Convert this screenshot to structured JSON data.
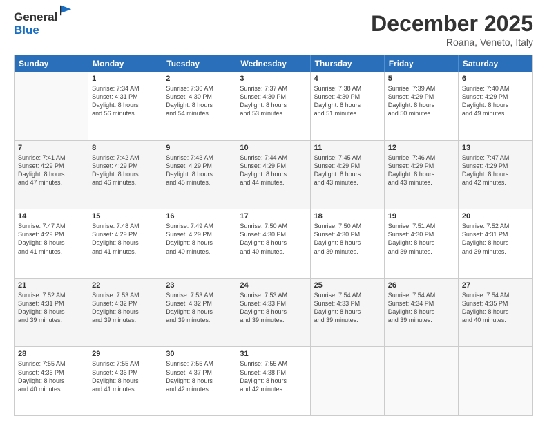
{
  "logo": {
    "general": "General",
    "blue": "Blue"
  },
  "title": "December 2025",
  "subtitle": "Roana, Veneto, Italy",
  "header_days": [
    "Sunday",
    "Monday",
    "Tuesday",
    "Wednesday",
    "Thursday",
    "Friday",
    "Saturday"
  ],
  "weeks": [
    [
      {
        "day": "",
        "info": ""
      },
      {
        "day": "1",
        "info": "Sunrise: 7:34 AM\nSunset: 4:31 PM\nDaylight: 8 hours\nand 56 minutes."
      },
      {
        "day": "2",
        "info": "Sunrise: 7:36 AM\nSunset: 4:30 PM\nDaylight: 8 hours\nand 54 minutes."
      },
      {
        "day": "3",
        "info": "Sunrise: 7:37 AM\nSunset: 4:30 PM\nDaylight: 8 hours\nand 53 minutes."
      },
      {
        "day": "4",
        "info": "Sunrise: 7:38 AM\nSunset: 4:30 PM\nDaylight: 8 hours\nand 51 minutes."
      },
      {
        "day": "5",
        "info": "Sunrise: 7:39 AM\nSunset: 4:29 PM\nDaylight: 8 hours\nand 50 minutes."
      },
      {
        "day": "6",
        "info": "Sunrise: 7:40 AM\nSunset: 4:29 PM\nDaylight: 8 hours\nand 49 minutes."
      }
    ],
    [
      {
        "day": "7",
        "info": "Sunrise: 7:41 AM\nSunset: 4:29 PM\nDaylight: 8 hours\nand 47 minutes."
      },
      {
        "day": "8",
        "info": "Sunrise: 7:42 AM\nSunset: 4:29 PM\nDaylight: 8 hours\nand 46 minutes."
      },
      {
        "day": "9",
        "info": "Sunrise: 7:43 AM\nSunset: 4:29 PM\nDaylight: 8 hours\nand 45 minutes."
      },
      {
        "day": "10",
        "info": "Sunrise: 7:44 AM\nSunset: 4:29 PM\nDaylight: 8 hours\nand 44 minutes."
      },
      {
        "day": "11",
        "info": "Sunrise: 7:45 AM\nSunset: 4:29 PM\nDaylight: 8 hours\nand 43 minutes."
      },
      {
        "day": "12",
        "info": "Sunrise: 7:46 AM\nSunset: 4:29 PM\nDaylight: 8 hours\nand 43 minutes."
      },
      {
        "day": "13",
        "info": "Sunrise: 7:47 AM\nSunset: 4:29 PM\nDaylight: 8 hours\nand 42 minutes."
      }
    ],
    [
      {
        "day": "14",
        "info": "Sunrise: 7:47 AM\nSunset: 4:29 PM\nDaylight: 8 hours\nand 41 minutes."
      },
      {
        "day": "15",
        "info": "Sunrise: 7:48 AM\nSunset: 4:29 PM\nDaylight: 8 hours\nand 41 minutes."
      },
      {
        "day": "16",
        "info": "Sunrise: 7:49 AM\nSunset: 4:29 PM\nDaylight: 8 hours\nand 40 minutes."
      },
      {
        "day": "17",
        "info": "Sunrise: 7:50 AM\nSunset: 4:30 PM\nDaylight: 8 hours\nand 40 minutes."
      },
      {
        "day": "18",
        "info": "Sunrise: 7:50 AM\nSunset: 4:30 PM\nDaylight: 8 hours\nand 39 minutes."
      },
      {
        "day": "19",
        "info": "Sunrise: 7:51 AM\nSunset: 4:30 PM\nDaylight: 8 hours\nand 39 minutes."
      },
      {
        "day": "20",
        "info": "Sunrise: 7:52 AM\nSunset: 4:31 PM\nDaylight: 8 hours\nand 39 minutes."
      }
    ],
    [
      {
        "day": "21",
        "info": "Sunrise: 7:52 AM\nSunset: 4:31 PM\nDaylight: 8 hours\nand 39 minutes."
      },
      {
        "day": "22",
        "info": "Sunrise: 7:53 AM\nSunset: 4:32 PM\nDaylight: 8 hours\nand 39 minutes."
      },
      {
        "day": "23",
        "info": "Sunrise: 7:53 AM\nSunset: 4:32 PM\nDaylight: 8 hours\nand 39 minutes."
      },
      {
        "day": "24",
        "info": "Sunrise: 7:53 AM\nSunset: 4:33 PM\nDaylight: 8 hours\nand 39 minutes."
      },
      {
        "day": "25",
        "info": "Sunrise: 7:54 AM\nSunset: 4:33 PM\nDaylight: 8 hours\nand 39 minutes."
      },
      {
        "day": "26",
        "info": "Sunrise: 7:54 AM\nSunset: 4:34 PM\nDaylight: 8 hours\nand 39 minutes."
      },
      {
        "day": "27",
        "info": "Sunrise: 7:54 AM\nSunset: 4:35 PM\nDaylight: 8 hours\nand 40 minutes."
      }
    ],
    [
      {
        "day": "28",
        "info": "Sunrise: 7:55 AM\nSunset: 4:36 PM\nDaylight: 8 hours\nand 40 minutes."
      },
      {
        "day": "29",
        "info": "Sunrise: 7:55 AM\nSunset: 4:36 PM\nDaylight: 8 hours\nand 41 minutes."
      },
      {
        "day": "30",
        "info": "Sunrise: 7:55 AM\nSunset: 4:37 PM\nDaylight: 8 hours\nand 42 minutes."
      },
      {
        "day": "31",
        "info": "Sunrise: 7:55 AM\nSunset: 4:38 PM\nDaylight: 8 hours\nand 42 minutes."
      },
      {
        "day": "",
        "info": ""
      },
      {
        "day": "",
        "info": ""
      },
      {
        "day": "",
        "info": ""
      }
    ]
  ]
}
